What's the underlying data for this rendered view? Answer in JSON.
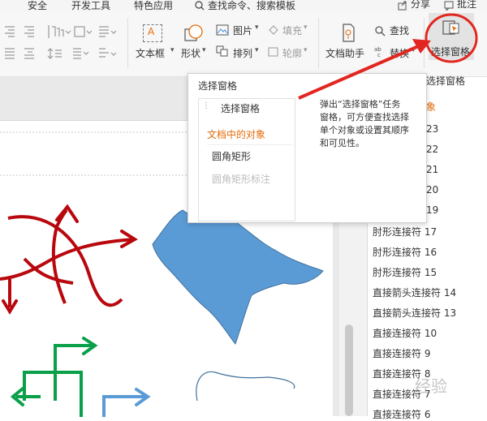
{
  "menu": {
    "security": "安全",
    "devtools": "开发工具",
    "features": "特色应用",
    "search": "查找命令、搜索模板",
    "share": "分享",
    "comment": "批注"
  },
  "ribbon": {
    "textbox": "文本框",
    "shape": "形状",
    "picture": "图片",
    "arrange": "排列",
    "fill": "填充",
    "outline": "轮廓",
    "doc_assistant": "文档助手",
    "find": "查找",
    "replace": "替换",
    "select_pane": "选择窗格"
  },
  "popup": {
    "title": "选择窗格",
    "mini_header": "选择窗格",
    "mini_section": "文档中的对象",
    "mini_item1": "圆角矩形",
    "mini_item2": "圆角矩形标注",
    "callout": [
      "弹出“选择窗格”任务",
      "窗格，可方便查找选择",
      "单个对象或设置其顺序",
      "和可见性。"
    ]
  },
  "pane": {
    "title": "选择窗格",
    "section": "象",
    "items": [
      "23",
      "22",
      "21",
      "20",
      "19",
      "肘形连接符 17",
      "肘形连接符 16",
      "肘形连接符 15",
      "直接箭头连接符 14",
      "直接箭头连接符 13",
      "直接连接符 10",
      "直接连接符 9",
      "直接连接符 8",
      "直接连接符 7",
      "直接连接符 6"
    ]
  },
  "watermark": "经验",
  "colors": {
    "accent": "#e2261f",
    "dark_red": "#b8070d",
    "green": "#0aa04a",
    "blue": "#5b9bd5",
    "orange": "#e46c0a"
  }
}
